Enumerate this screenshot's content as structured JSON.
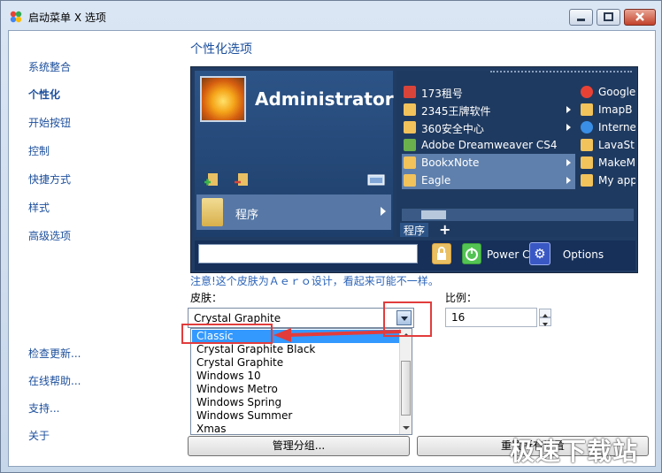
{
  "window": {
    "title": "启动菜单 X 选项"
  },
  "sidebar": {
    "items": [
      {
        "label": "系统整合"
      },
      {
        "label": "个性化"
      },
      {
        "label": "开始按钮"
      },
      {
        "label": "控制"
      },
      {
        "label": "快捷方式"
      },
      {
        "label": "样式"
      },
      {
        "label": "高级选项"
      },
      {
        "label": "检查更新..."
      },
      {
        "label": "在线帮助..."
      },
      {
        "label": "支持..."
      },
      {
        "label": "关于"
      }
    ],
    "active_index": 1
  },
  "main": {
    "heading": "个性化选项",
    "preview": {
      "username": "Administrator",
      "programs_label": "程序",
      "tab_label": "程序",
      "tab_add": "+",
      "power_label": "Power Co",
      "options_label": "Options",
      "right_col1": [
        {
          "label": "173租号",
          "icon_color": "#d9443a",
          "arrow": false
        },
        {
          "label": "2345王牌软件",
          "icon_color": "#f2c25b",
          "arrow": true
        },
        {
          "label": "360安全中心",
          "icon_color": "#f2c25b",
          "arrow": true
        },
        {
          "label": "Adobe Dreamweaver CS4",
          "icon_color": "#6ab04c",
          "arrow": false
        },
        {
          "label": "BookxNote",
          "icon_color": "#f2c25b",
          "arrow": true
        },
        {
          "label": "Eagle",
          "icon_color": "#f2c25b",
          "arrow": true
        }
      ],
      "right_col2": [
        {
          "label": "Google",
          "icon_color": "#e94235"
        },
        {
          "label": "ImapB",
          "icon_color": "#f2c25b"
        },
        {
          "label": "Interne",
          "icon_color": "#3a8ee6"
        },
        {
          "label": "LavaSt",
          "icon_color": "#f2c25b"
        },
        {
          "label": "MakeM",
          "icon_color": "#f2c25b"
        },
        {
          "label": "My app",
          "icon_color": "#f2c25b"
        }
      ]
    },
    "note": "注意!这个皮肤为Ａｅｒｏ设计，看起来可能不一样。",
    "skin_label": "皮肤：",
    "skin_selected": "Crystal Graphite",
    "skin_options": [
      "Classic",
      "Crystal Graphite Black",
      "Crystal Graphite",
      "Windows 10",
      "Windows Metro",
      "Windows Spring",
      "Windows Summer",
      "Xmas"
    ],
    "skin_highlighted_index": 0,
    "ratio_label": "比例：",
    "ratio_value": "16",
    "manage_button": "管理分组...",
    "reset_button": "重置所有设置"
  },
  "watermark": "极速下载站",
  "colors": {
    "accent": "#1c4f9c",
    "annotation": "#e23c3c",
    "selection": "#3399ff"
  }
}
